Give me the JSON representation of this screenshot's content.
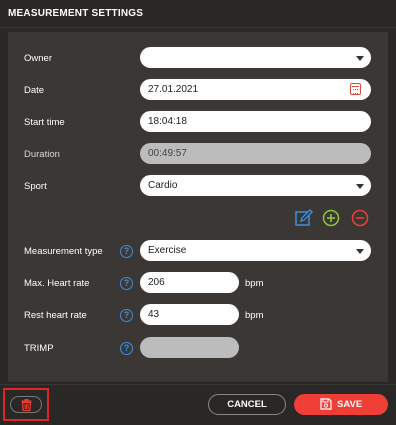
{
  "header": {
    "title": "MEASUREMENT SETTINGS"
  },
  "form": {
    "owner": {
      "label": "Owner",
      "value": ""
    },
    "date": {
      "label": "Date",
      "value": "27.01.2021"
    },
    "start_time": {
      "label": "Start time",
      "value": "18:04:18"
    },
    "duration": {
      "label": "Duration",
      "value": "00:49:57"
    },
    "sport": {
      "label": "Sport",
      "value": "Cardio"
    },
    "measurement_type": {
      "label": "Measurement type",
      "value": "Exercise"
    },
    "max_heart_rate": {
      "label": "Max. Heart rate",
      "value": "206",
      "unit": "bpm"
    },
    "rest_heart_rate": {
      "label": "Rest heart rate",
      "value": "43",
      "unit": "bpm"
    },
    "trimp": {
      "label": "TRIMP",
      "value": ""
    }
  },
  "help": {
    "glyph": "?"
  },
  "actions": {
    "cancel_label": "CANCEL",
    "save_label": "SAVE"
  },
  "icons": {
    "edit": "edit-icon",
    "add": "plus-circle-icon",
    "remove": "minus-circle-icon",
    "delete": "trash-icon",
    "calendar": "calendar-icon",
    "save": "floppy-disk-icon"
  },
  "colors": {
    "accent_red": "#ef3e36",
    "accent_blue": "#3e8fe0",
    "accent_green": "#8cc43c",
    "highlight_border": "#e0242a"
  }
}
